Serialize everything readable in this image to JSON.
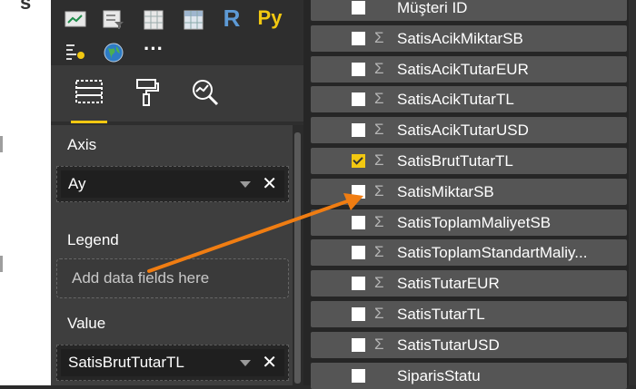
{
  "viz_icons": [
    {
      "name": "kpi-icon"
    },
    {
      "name": "slicer-icon"
    },
    {
      "name": "table-icon"
    },
    {
      "name": "matrix-icon"
    },
    {
      "name": "r-visual-icon",
      "label": "R"
    },
    {
      "name": "python-visual-icon",
      "label": "Py"
    },
    {
      "name": "key-influencers-icon"
    },
    {
      "name": "globe-icon"
    },
    {
      "name": "more-icon",
      "label": "···"
    }
  ],
  "wells": {
    "axis": {
      "label": "Axis",
      "value": "Ay"
    },
    "legend": {
      "label": "Legend",
      "placeholder": "Add data fields here"
    },
    "value": {
      "label": "Value",
      "value": "SatisBrutTutarTL"
    }
  },
  "fields": [
    {
      "name": "Müşteri ID",
      "checked": false,
      "sigma": false
    },
    {
      "name": "SatisAcikMiktarSB",
      "checked": false,
      "sigma": true
    },
    {
      "name": "SatisAcikTutarEUR",
      "checked": false,
      "sigma": true
    },
    {
      "name": "SatisAcikTutarTL",
      "checked": false,
      "sigma": true
    },
    {
      "name": "SatisAcikTutarUSD",
      "checked": false,
      "sigma": true
    },
    {
      "name": "SatisBrutTutarTL",
      "checked": true,
      "sigma": true
    },
    {
      "name": "SatisMiktarSB",
      "checked": false,
      "sigma": true
    },
    {
      "name": "SatisToplamMaliyetSB",
      "checked": false,
      "sigma": true
    },
    {
      "name": "SatisToplamStandartMaliy...",
      "checked": false,
      "sigma": true
    },
    {
      "name": "SatisTutarEUR",
      "checked": false,
      "sigma": true
    },
    {
      "name": "SatisTutarTL",
      "checked": false,
      "sigma": true
    },
    {
      "name": "SatisTutarUSD",
      "checked": false,
      "sigma": true
    },
    {
      "name": "SiparisStatu",
      "checked": false,
      "sigma": false
    }
  ],
  "sigma_symbol": "Σ",
  "close_symbol": "✕",
  "colors": {
    "accent": "#f2c811",
    "arrow": "#f07d12"
  }
}
